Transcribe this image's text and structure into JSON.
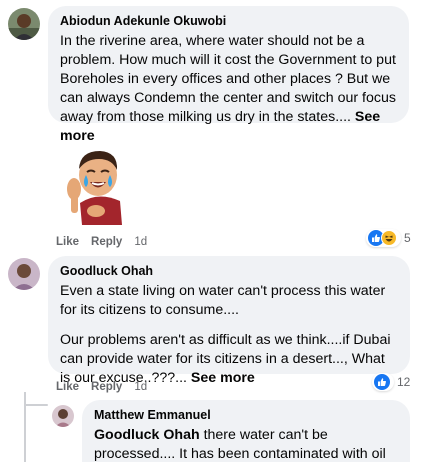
{
  "comments": [
    {
      "author": "Abiodun Adekunle Okuwobi",
      "text": "In the riverine area, where water should not be a problem. How much will it cost the Government to put Boreholes in every offices and other places ? But we can always Condemn the center and switch our focus away from those milking us dry in the states....",
      "see_more": "See more",
      "actions": {
        "like": "Like",
        "reply": "Reply",
        "time": "1d"
      },
      "reactions": {
        "count": "5",
        "icons": [
          "like-icon",
          "haha-icon"
        ]
      },
      "sticker": "crying-laughing-man-sticker"
    },
    {
      "author": "Goodluck Ohah",
      "paragraph1": "Even a state living on water can't process this water for its citizens to consume....",
      "paragraph2": "Our problems aren't as difficult as we think....if Dubai can provide water for its citizens in a desert..., What is our excuse..???...",
      "see_more": "See more",
      "actions": {
        "like": "Like",
        "reply": "Reply",
        "time": "1d"
      },
      "reactions": {
        "count": "12",
        "icons": [
          "like-icon"
        ]
      }
    },
    {
      "author": "Matthew Emmanuel",
      "mention": "Goodluck Ohah",
      "text": "there water can't be processed.... It has been contaminated with oil waste.. Lot of"
    }
  ],
  "colors": {
    "bubble": "#f0f2f5",
    "meta": "#65676b",
    "like_blue": "#1877f2",
    "haha_yellow": "#f7b928"
  }
}
